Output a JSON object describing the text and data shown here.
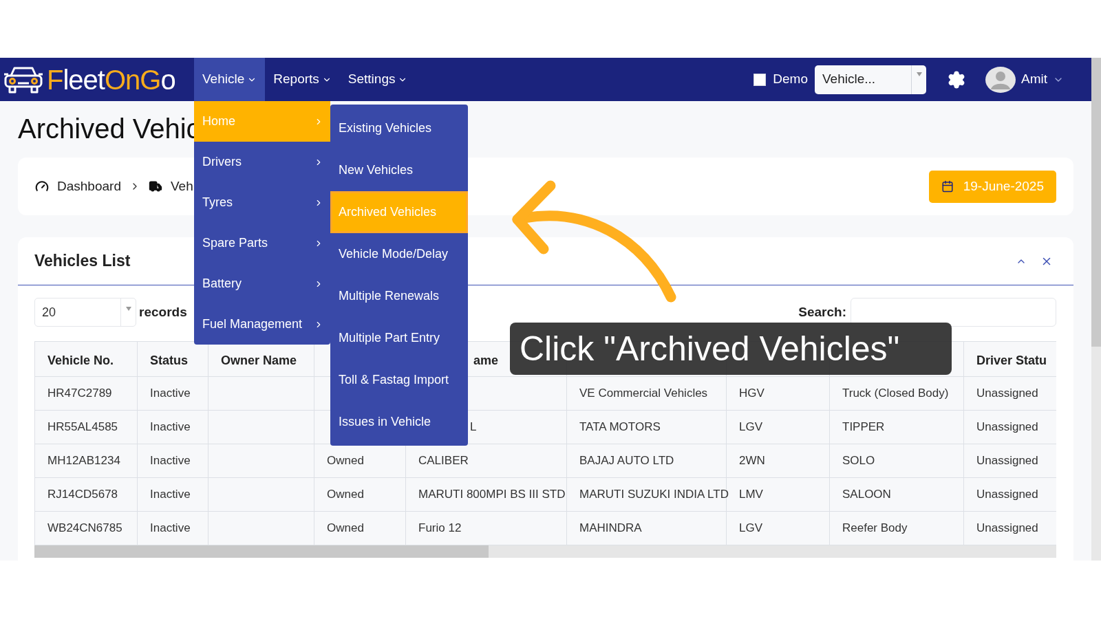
{
  "header": {
    "logo": [
      {
        "text": "F",
        "accent": true
      },
      {
        "text": "leet",
        "accent": false
      },
      {
        "text": "OnG",
        "accent": true
      },
      {
        "text": "o",
        "accent": false
      }
    ],
    "nav": [
      {
        "label": "Vehicle",
        "selected": true
      },
      {
        "label": "Reports",
        "selected": false
      },
      {
        "label": "Settings",
        "selected": false
      }
    ],
    "demo": {
      "label": "Demo",
      "checked": false
    },
    "vehicle_select": {
      "value": "Vehicle..."
    },
    "user": {
      "name": "Amit"
    }
  },
  "page": {
    "title": "Archived Vehic"
  },
  "breadcrumb": [
    {
      "label": "Dashboard",
      "kind": "gauge"
    },
    {
      "label": "Veh",
      "kind": "truck"
    }
  ],
  "date_button": "19-June-2025",
  "card": {
    "title": "Vehicles List",
    "page_size": "20",
    "records_label": "records",
    "search_label": "Search:"
  },
  "table": {
    "columns": [
      {
        "label": "Vehicle No."
      },
      {
        "label": "Status"
      },
      {
        "label": "Owner Name"
      },
      {},
      {
        "label": "ame"
      },
      {},
      {},
      {},
      {
        "label": "Driver Statu"
      }
    ],
    "rows": [
      {
        "cells": [
          "HR47C2789",
          "Inactive",
          "",
          "",
          "",
          "VE Commercial Vehicles",
          "HGV",
          "Truck (Closed Body)",
          "Unassigned"
        ]
      },
      {
        "cells": [
          "HR55AL4585",
          "Inactive",
          "",
          "",
          "L",
          "TATA MOTORS",
          "LGV",
          "TIPPER",
          "Unassigned"
        ]
      },
      {
        "cells": [
          "MH12AB1234",
          "Inactive",
          "",
          "Owned",
          "CALIBER",
          "BAJAJ AUTO LTD",
          "2WN",
          "SOLO",
          "Unassigned"
        ]
      },
      {
        "cells": [
          "RJ14CD5678",
          "Inactive",
          "",
          "Owned",
          "MARUTI 800MPI BS III STD",
          "MARUTI SUZUKI INDIA LTD",
          "LMV",
          "SALOON",
          "Unassigned"
        ]
      },
      {
        "cells": [
          "WB24CN6785",
          "Inactive",
          "",
          "Owned",
          "Furio 12",
          "MAHINDRA",
          "LGV",
          "Reefer Body",
          "Unassigned"
        ]
      }
    ]
  },
  "vehicle_menu": [
    {
      "label": "Home",
      "selected": true
    },
    {
      "label": "Drivers",
      "selected": false
    },
    {
      "label": "Tyres",
      "selected": false
    },
    {
      "label": "Spare Parts",
      "selected": false
    },
    {
      "label": "Battery",
      "selected": false
    },
    {
      "label": "Fuel Management",
      "selected": false
    }
  ],
  "submenu": [
    {
      "label": "Existing Vehicles",
      "selected": false
    },
    {
      "label": "New Vehicles",
      "selected": false
    },
    {
      "label": "Archived Vehicles",
      "selected": true
    },
    {
      "label": "Vehicle Mode/Delay",
      "selected": false
    },
    {
      "label": "Multiple Renewals",
      "selected": false
    },
    {
      "label": "Multiple Part Entry",
      "selected": false
    },
    {
      "label": "Toll & Fastag Import",
      "selected": false
    },
    {
      "label": "Issues in Vehicle",
      "selected": false
    }
  ],
  "tooltip": "Click \"Archived Vehicles\""
}
